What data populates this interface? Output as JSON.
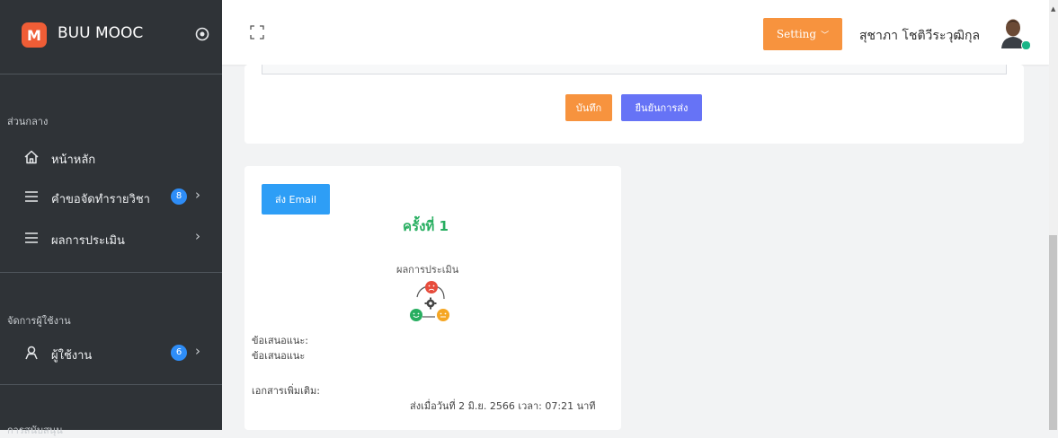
{
  "sidebar": {
    "brand": {
      "logo_letter": "M",
      "title": "BUU MOOC"
    },
    "sections": [
      {
        "label": "ส่วนกลาง"
      },
      {
        "label": "จัดการผู้ใช้งาน"
      },
      {
        "label": "การสนับสนุน"
      }
    ],
    "items": [
      {
        "label": "หน้าหลัก",
        "icon": "home-icon"
      },
      {
        "label": "คำขอจัดทำรายวิชา",
        "badge": "8",
        "icon": "menu-icon"
      },
      {
        "label": "ผลการประเมิน",
        "icon": "menu-icon"
      },
      {
        "label": "ผู้ใช้งาน",
        "badge": "6",
        "icon": "user-icon"
      }
    ]
  },
  "topbar": {
    "setting_label": "Setting",
    "user_name": "สุชาภา โชติวีระวุฒิกุล"
  },
  "form_card": {
    "save_label": "บันทึก",
    "confirm_label": "ยืนยันการส่ง"
  },
  "email_card": {
    "email_button": "ส่ง Email",
    "round_title": "ครั้งที่ 1",
    "evaluation_label": "ผลการประเมิน",
    "suggestion_heading": "ข้อเสนอแนะ:",
    "suggestion_value": "ข้อเสนอแนะ",
    "attachment_label": "เอกสารเพิ่มเติม:",
    "sent_date": "ส่งเมื่อวันที่ 2 มิ.ย. 2566 เวลา: 07:21 นาที"
  },
  "colors": {
    "sidebar_bg": "#2f3337",
    "accent_orange": "#f7933e",
    "accent_purple": "#6673f6",
    "accent_blue": "#2e9ef6",
    "success_green": "#27ae60",
    "badge_blue": "#2e8df7"
  }
}
